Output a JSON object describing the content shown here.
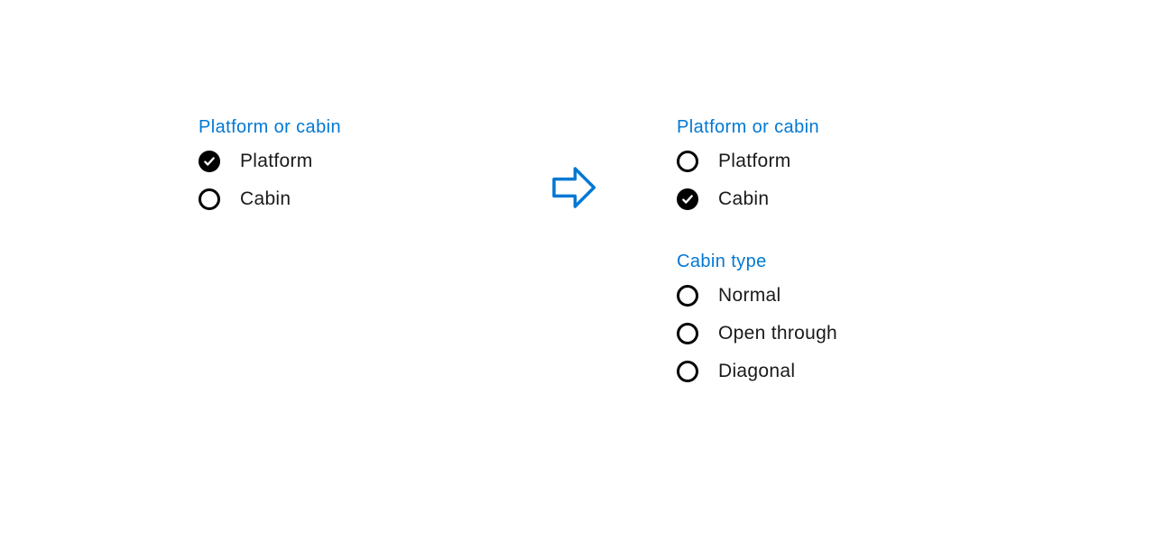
{
  "colors": {
    "accent": "#0078d4",
    "text": "#1a1a1a",
    "radio_fill": "#000000"
  },
  "left_panel": {
    "group1": {
      "title": "Platform or cabin",
      "options": [
        {
          "label": "Platform",
          "selected": true
        },
        {
          "label": "Cabin",
          "selected": false
        }
      ]
    }
  },
  "right_panel": {
    "group1": {
      "title": "Platform or cabin",
      "options": [
        {
          "label": "Platform",
          "selected": false
        },
        {
          "label": "Cabin",
          "selected": true
        }
      ]
    },
    "group2": {
      "title": "Cabin type",
      "options": [
        {
          "label": "Normal",
          "selected": false
        },
        {
          "label": "Open through",
          "selected": false
        },
        {
          "label": "Diagonal",
          "selected": false
        }
      ]
    }
  },
  "arrow": {
    "name": "arrow-right-icon"
  }
}
